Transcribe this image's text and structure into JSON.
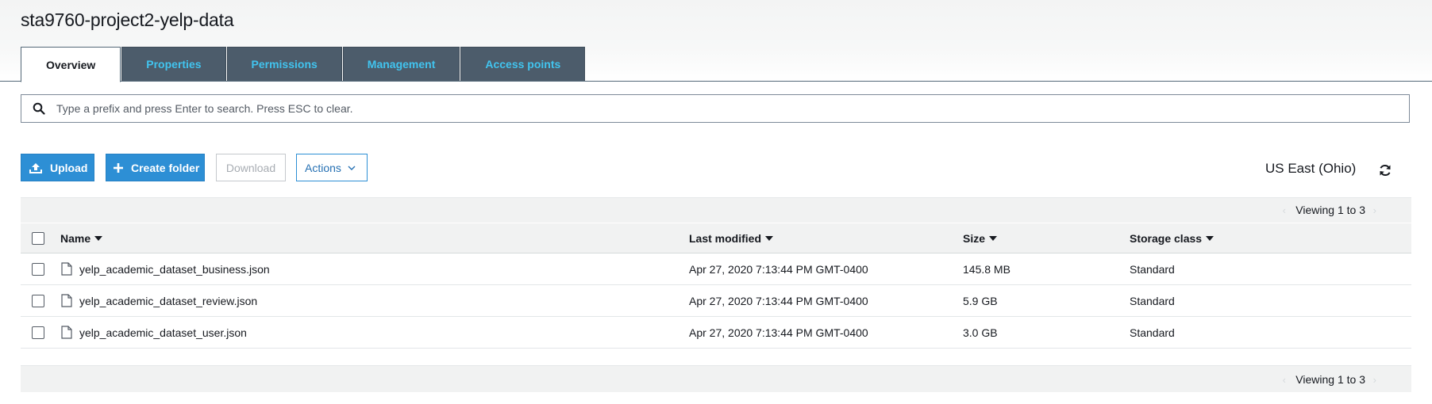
{
  "bucket": {
    "name": "sta9760-project2-yelp-data"
  },
  "tabs": [
    {
      "label": "Overview",
      "active": true
    },
    {
      "label": "Properties",
      "active": false
    },
    {
      "label": "Permissions",
      "active": false
    },
    {
      "label": "Management",
      "active": false
    },
    {
      "label": "Access points",
      "active": false
    }
  ],
  "search": {
    "placeholder": "Type a prefix and press Enter to search. Press ESC to clear.",
    "value": ""
  },
  "toolbar": {
    "upload_label": "Upload",
    "create_folder_label": "Create folder",
    "download_label": "Download",
    "actions_label": "Actions",
    "region": "US East (Ohio)"
  },
  "table": {
    "viewing_top": "Viewing 1 to 3",
    "viewing_bottom": "Viewing 1 to 3",
    "columns": [
      "Name",
      "Last modified",
      "Size",
      "Storage class"
    ],
    "rows": [
      {
        "name": "yelp_academic_dataset_business.json",
        "last_modified": "Apr 27, 2020 7:13:44 PM GMT-0400",
        "size": "145.8 MB",
        "storage_class": "Standard"
      },
      {
        "name": "yelp_academic_dataset_review.json",
        "last_modified": "Apr 27, 2020 7:13:44 PM GMT-0400",
        "size": "5.9 GB",
        "storage_class": "Standard"
      },
      {
        "name": "yelp_academic_dataset_user.json",
        "last_modified": "Apr 27, 2020 7:13:44 PM GMT-0400",
        "size": "3.0 GB",
        "storage_class": "Standard"
      }
    ]
  },
  "colors": {
    "primary_button": "#2d8fd5",
    "tab_background": "#4c5c6b",
    "tab_text": "#41c4ef"
  }
}
